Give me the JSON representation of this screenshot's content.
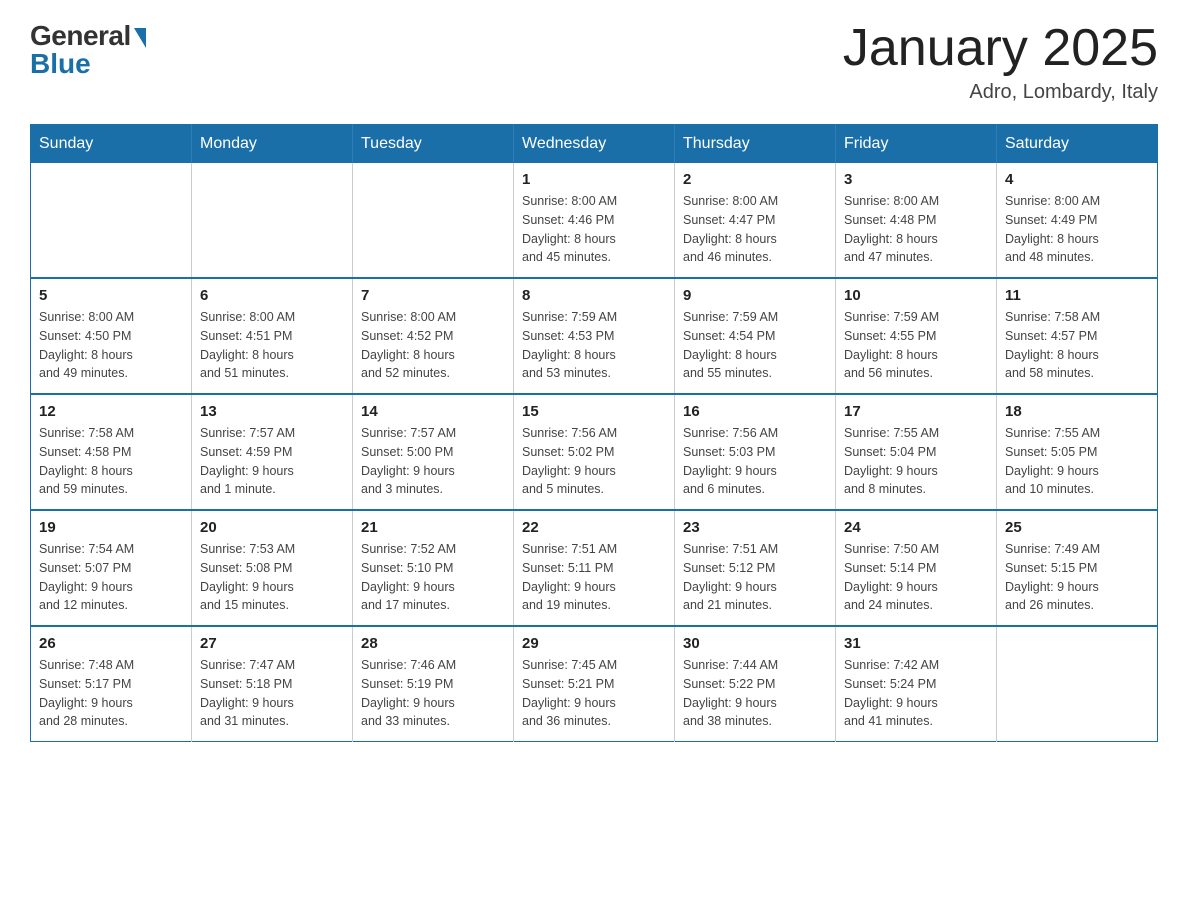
{
  "header": {
    "logo_general": "General",
    "logo_blue": "Blue",
    "month_title": "January 2025",
    "location": "Adro, Lombardy, Italy"
  },
  "calendar": {
    "days_of_week": [
      "Sunday",
      "Monday",
      "Tuesday",
      "Wednesday",
      "Thursday",
      "Friday",
      "Saturday"
    ],
    "weeks": [
      [
        {
          "day": "",
          "info": ""
        },
        {
          "day": "",
          "info": ""
        },
        {
          "day": "",
          "info": ""
        },
        {
          "day": "1",
          "info": "Sunrise: 8:00 AM\nSunset: 4:46 PM\nDaylight: 8 hours\nand 45 minutes."
        },
        {
          "day": "2",
          "info": "Sunrise: 8:00 AM\nSunset: 4:47 PM\nDaylight: 8 hours\nand 46 minutes."
        },
        {
          "day": "3",
          "info": "Sunrise: 8:00 AM\nSunset: 4:48 PM\nDaylight: 8 hours\nand 47 minutes."
        },
        {
          "day": "4",
          "info": "Sunrise: 8:00 AM\nSunset: 4:49 PM\nDaylight: 8 hours\nand 48 minutes."
        }
      ],
      [
        {
          "day": "5",
          "info": "Sunrise: 8:00 AM\nSunset: 4:50 PM\nDaylight: 8 hours\nand 49 minutes."
        },
        {
          "day": "6",
          "info": "Sunrise: 8:00 AM\nSunset: 4:51 PM\nDaylight: 8 hours\nand 51 minutes."
        },
        {
          "day": "7",
          "info": "Sunrise: 8:00 AM\nSunset: 4:52 PM\nDaylight: 8 hours\nand 52 minutes."
        },
        {
          "day": "8",
          "info": "Sunrise: 7:59 AM\nSunset: 4:53 PM\nDaylight: 8 hours\nand 53 minutes."
        },
        {
          "day": "9",
          "info": "Sunrise: 7:59 AM\nSunset: 4:54 PM\nDaylight: 8 hours\nand 55 minutes."
        },
        {
          "day": "10",
          "info": "Sunrise: 7:59 AM\nSunset: 4:55 PM\nDaylight: 8 hours\nand 56 minutes."
        },
        {
          "day": "11",
          "info": "Sunrise: 7:58 AM\nSunset: 4:57 PM\nDaylight: 8 hours\nand 58 minutes."
        }
      ],
      [
        {
          "day": "12",
          "info": "Sunrise: 7:58 AM\nSunset: 4:58 PM\nDaylight: 8 hours\nand 59 minutes."
        },
        {
          "day": "13",
          "info": "Sunrise: 7:57 AM\nSunset: 4:59 PM\nDaylight: 9 hours\nand 1 minute."
        },
        {
          "day": "14",
          "info": "Sunrise: 7:57 AM\nSunset: 5:00 PM\nDaylight: 9 hours\nand 3 minutes."
        },
        {
          "day": "15",
          "info": "Sunrise: 7:56 AM\nSunset: 5:02 PM\nDaylight: 9 hours\nand 5 minutes."
        },
        {
          "day": "16",
          "info": "Sunrise: 7:56 AM\nSunset: 5:03 PM\nDaylight: 9 hours\nand 6 minutes."
        },
        {
          "day": "17",
          "info": "Sunrise: 7:55 AM\nSunset: 5:04 PM\nDaylight: 9 hours\nand 8 minutes."
        },
        {
          "day": "18",
          "info": "Sunrise: 7:55 AM\nSunset: 5:05 PM\nDaylight: 9 hours\nand 10 minutes."
        }
      ],
      [
        {
          "day": "19",
          "info": "Sunrise: 7:54 AM\nSunset: 5:07 PM\nDaylight: 9 hours\nand 12 minutes."
        },
        {
          "day": "20",
          "info": "Sunrise: 7:53 AM\nSunset: 5:08 PM\nDaylight: 9 hours\nand 15 minutes."
        },
        {
          "day": "21",
          "info": "Sunrise: 7:52 AM\nSunset: 5:10 PM\nDaylight: 9 hours\nand 17 minutes."
        },
        {
          "day": "22",
          "info": "Sunrise: 7:51 AM\nSunset: 5:11 PM\nDaylight: 9 hours\nand 19 minutes."
        },
        {
          "day": "23",
          "info": "Sunrise: 7:51 AM\nSunset: 5:12 PM\nDaylight: 9 hours\nand 21 minutes."
        },
        {
          "day": "24",
          "info": "Sunrise: 7:50 AM\nSunset: 5:14 PM\nDaylight: 9 hours\nand 24 minutes."
        },
        {
          "day": "25",
          "info": "Sunrise: 7:49 AM\nSunset: 5:15 PM\nDaylight: 9 hours\nand 26 minutes."
        }
      ],
      [
        {
          "day": "26",
          "info": "Sunrise: 7:48 AM\nSunset: 5:17 PM\nDaylight: 9 hours\nand 28 minutes."
        },
        {
          "day": "27",
          "info": "Sunrise: 7:47 AM\nSunset: 5:18 PM\nDaylight: 9 hours\nand 31 minutes."
        },
        {
          "day": "28",
          "info": "Sunrise: 7:46 AM\nSunset: 5:19 PM\nDaylight: 9 hours\nand 33 minutes."
        },
        {
          "day": "29",
          "info": "Sunrise: 7:45 AM\nSunset: 5:21 PM\nDaylight: 9 hours\nand 36 minutes."
        },
        {
          "day": "30",
          "info": "Sunrise: 7:44 AM\nSunset: 5:22 PM\nDaylight: 9 hours\nand 38 minutes."
        },
        {
          "day": "31",
          "info": "Sunrise: 7:42 AM\nSunset: 5:24 PM\nDaylight: 9 hours\nand 41 minutes."
        },
        {
          "day": "",
          "info": ""
        }
      ]
    ]
  }
}
